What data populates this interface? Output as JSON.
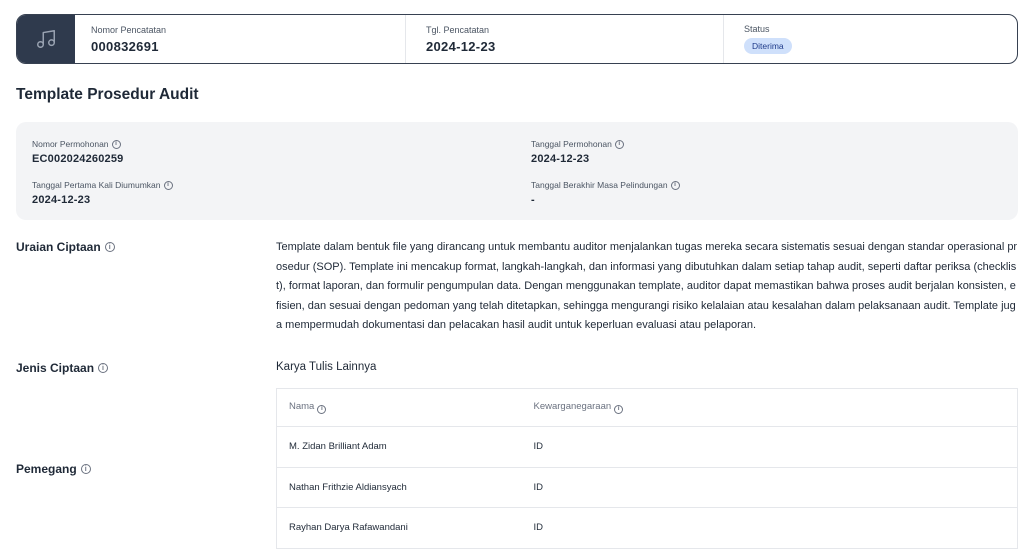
{
  "header": {
    "icon": "music-note-icon",
    "registration_number_label": "Nomor Pencatatan",
    "registration_number": "000832691",
    "registration_date_label": "Tgl. Pencatatan",
    "registration_date": "2024-12-23",
    "status_label": "Status",
    "status": "Diterima"
  },
  "title": "Template Prosedur Audit",
  "details": {
    "application_number_label": "Nomor Permohonan",
    "application_number": "EC002024260259",
    "application_date_label": "Tanggal Permohonan",
    "application_date": "2024-12-23",
    "first_published_label": "Tanggal Pertama Kali Diumumkan",
    "first_published": "2024-12-23",
    "protection_end_label": "Tanggal Berakhir Masa Pelindungan",
    "protection_end": "-"
  },
  "description": {
    "label": "Uraian Ciptaan",
    "text": "Template dalam bentuk file yang dirancang untuk membantu auditor menjalankan tugas mereka secara sistematis sesuai dengan standar operasional prosedur (SOP). Template ini mencakup format, langkah-langkah, dan informasi yang dibutuhkan dalam setiap tahap audit, seperti daftar periksa (checklist), format laporan, dan formulir pengumpulan data. Dengan menggunakan template, auditor dapat memastikan bahwa proses audit berjalan konsisten, efisien, dan sesuai dengan pedoman yang telah ditetapkan, sehingga mengurangi risiko kelalaian atau kesalahan dalam pelaksanaan audit. Template juga mempermudah dokumentasi dan pelacakan hasil audit untuk keperluan evaluasi atau pelaporan."
  },
  "work_type": {
    "label": "Jenis Ciptaan",
    "value": "Karya Tulis Lainnya"
  },
  "holders": {
    "label": "Pemegang",
    "columns": [
      "Nama",
      "Kewarganegaraan"
    ],
    "rows": [
      {
        "name": "M. Zidan Brilliant Adam",
        "nationality": "ID"
      },
      {
        "name": "Nathan Frithzie Aldiansyach",
        "nationality": "ID"
      },
      {
        "name": "Rayhan Darya Rafawandani",
        "nationality": "ID"
      }
    ]
  }
}
